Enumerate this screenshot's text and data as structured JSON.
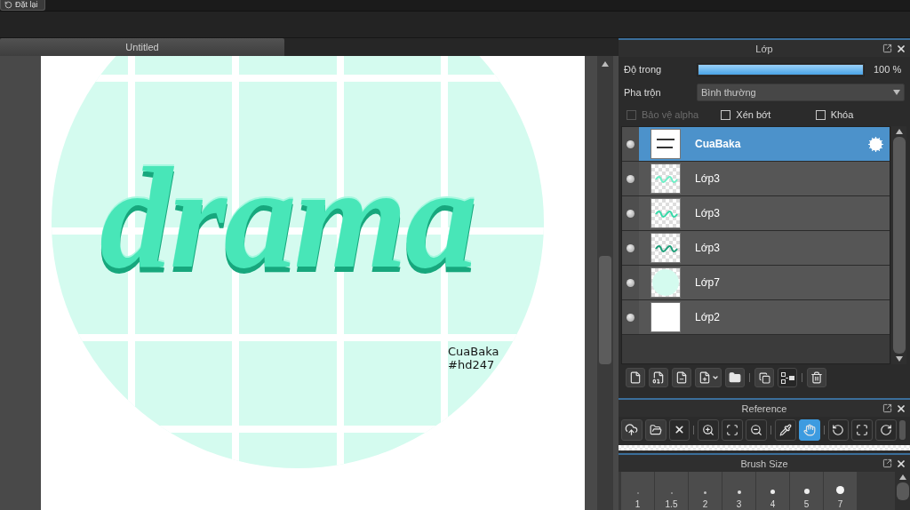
{
  "top_bar": {
    "reset_button": "Đặt lại"
  },
  "document_tabs": [
    {
      "label": "Untitled",
      "selected": true
    }
  ],
  "canvas": {
    "lettering": "drama",
    "signature": [
      "CuaBaka",
      "#hd247"
    ]
  },
  "layer_panel": {
    "title": "Lớp",
    "opacity": {
      "label": "Độ trong",
      "level": 1,
      "reading": "100 %"
    },
    "blend": {
      "label": "Pha trộn",
      "value": "Bình thường"
    },
    "options": [
      {
        "label": "Bảo vệ alpha",
        "checked": false,
        "disabled": true
      },
      {
        "label": "Xén bớt",
        "checked": false,
        "disabled": false
      },
      {
        "label": "Khóa",
        "checked": false,
        "disabled": false
      }
    ],
    "layers": [
      {
        "name": "CuaBaka",
        "selected": true,
        "thumbnail": {
          "kind": "signature"
        }
      },
      {
        "name": "Lớp3",
        "selected": false,
        "thumbnail": {
          "kind": "lettering-light"
        }
      },
      {
        "name": "Lớp3",
        "selected": false,
        "thumbnail": {
          "kind": "lettering"
        }
      },
      {
        "name": "Lớp3",
        "selected": false,
        "thumbnail": {
          "kind": "lettering-dark"
        }
      },
      {
        "name": "Lớp7",
        "selected": false,
        "thumbnail": {
          "kind": "circle"
        }
      },
      {
        "name": "Lớp2",
        "selected": false,
        "thumbnail": {
          "kind": "fill"
        }
      }
    ]
  },
  "reference_panel": {
    "title": "Reference",
    "tools": [
      {
        "kind": "eyedropper",
        "selected": false
      },
      {
        "kind": "hand",
        "selected": true
      }
    ]
  },
  "brush_panel": {
    "title": "Brush Size",
    "sizes": [
      "1",
      "1.5",
      "2",
      "3",
      "4",
      "5",
      "7"
    ]
  }
}
